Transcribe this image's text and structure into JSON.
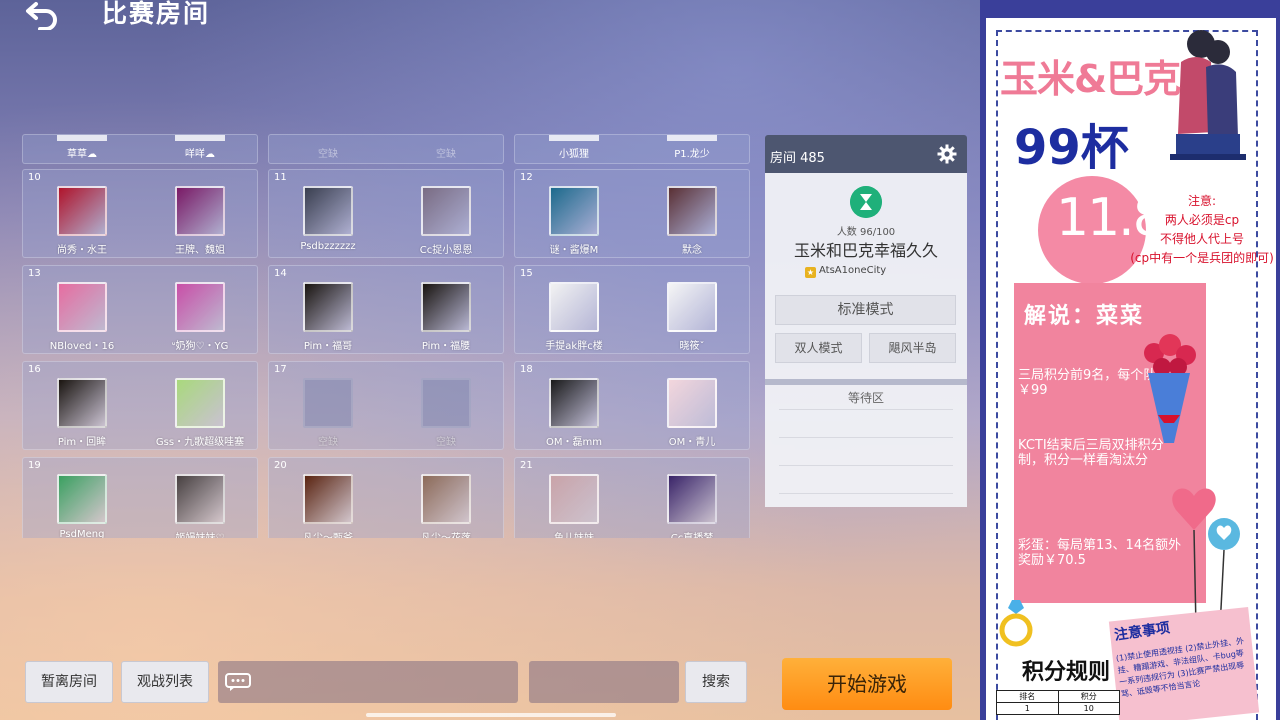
{
  "header": {
    "title": "比赛房间",
    "back_icon": "back-arrow-icon"
  },
  "top_row": [
    {
      "players": [
        {
          "name": "草草☁",
          "empty": false
        },
        {
          "name": "咩咩☁",
          "empty": false
        }
      ]
    },
    {
      "players": [
        {
          "name": "空缺",
          "empty": true
        },
        {
          "name": "空缺",
          "empty": true
        }
      ]
    },
    {
      "players": [
        {
          "name": "小狐狸",
          "empty": false
        },
        {
          "name": "P1.龙少",
          "empty": false
        }
      ]
    }
  ],
  "slots": [
    {
      "num": "10",
      "players": [
        {
          "name": "尚秀・水王",
          "empty": false,
          "color": "#b0142b"
        },
        {
          "name": "王牌、魏姐",
          "empty": false,
          "color": "#7a1a66"
        }
      ]
    },
    {
      "num": "11",
      "players": [
        {
          "name": "Psdbzzzzzz",
          "empty": false,
          "color": "#3a3f4f"
        },
        {
          "name": "Cc捉小恩恩",
          "empty": false,
          "color": "#7a6c83"
        }
      ]
    },
    {
      "num": "12",
      "players": [
        {
          "name": "谜・酱爆M",
          "empty": false,
          "color": "#1c6a8c"
        },
        {
          "name": "默念",
          "empty": false,
          "color": "#5a3034"
        }
      ]
    },
    {
      "num": "13",
      "players": [
        {
          "name": "NBloved・16",
          "empty": false,
          "color": "#e76da0"
        },
        {
          "name": "ᐡ奶狗♡・YG",
          "empty": false,
          "color": "#c94fa7"
        }
      ]
    },
    {
      "num": "14",
      "players": [
        {
          "name": "Pim・福哥",
          "empty": false,
          "color": "#1a1510"
        },
        {
          "name": "Pim・福腰",
          "empty": false,
          "color": "#1a1510"
        }
      ]
    },
    {
      "num": "15",
      "players": [
        {
          "name": "手提ak胖c楼",
          "empty": false,
          "color": "#f2f2f2"
        },
        {
          "name": "晓筱ˇ",
          "empty": false,
          "color": "#f5f5f5"
        }
      ]
    },
    {
      "num": "16",
      "players": [
        {
          "name": "Pim・回眸",
          "empty": false,
          "color": "#1a1510"
        },
        {
          "name": "Gss・九歌超级哇塞",
          "empty": false,
          "color": "#a9d97c"
        }
      ]
    },
    {
      "num": "17",
      "players": [
        {
          "name": "空缺",
          "empty": true
        },
        {
          "name": "空缺",
          "empty": true
        }
      ]
    },
    {
      "num": "18",
      "players": [
        {
          "name": "OM・磊mm",
          "empty": false,
          "color": "#1a1a1a"
        },
        {
          "name": "OM・青儿",
          "empty": false,
          "color": "#f3d6dc"
        }
      ]
    },
    {
      "num": "19",
      "players": [
        {
          "name": "PsdMeng",
          "empty": false,
          "color": "#3aa060"
        },
        {
          "name": "姬嫚妹妹♡",
          "empty": false,
          "color": "#474040"
        }
      ]
    },
    {
      "num": "20",
      "players": [
        {
          "name": "凡尘～甄爷",
          "empty": false,
          "color": "#5a2410"
        },
        {
          "name": "凡尘～花落",
          "empty": false,
          "color": "#8c6a58"
        }
      ]
    },
    {
      "num": "21",
      "players": [
        {
          "name": "鱼儿妹妹",
          "empty": false,
          "color": "#c9a3a8"
        },
        {
          "name": "Cc直播梦",
          "empty": false,
          "color": "#3a2468"
        }
      ]
    }
  ],
  "room": {
    "title": "房间 485",
    "count": "人数 96/100",
    "name": "玉米和巴克幸福久久",
    "owner": "AtsA1oneCity",
    "mode_standard": "标准模式",
    "mode_duo": "双人模式",
    "map": "飓风半岛",
    "waiting_area": "等待区"
  },
  "bottom": {
    "leave": "暂离房间",
    "spectate": "观战列表",
    "search": "搜索",
    "start": "开始游戏"
  },
  "poster": {
    "title": "玉米&巴克",
    "cup": "99杯",
    "date": "11.8",
    "note_lines": [
      "注意:",
      "两人必须是cp",
      "不得他人代上号",
      "(cp中有一个是兵团的即可)"
    ],
    "host": "解说：菜菜",
    "rule1": "三局积分前9名，每个队伍￥99",
    "rule2": "KCTI结束后三局双排积分制，积分一样看淘汰分",
    "rule3": "彩蛋：每局第13、14名额外奖励￥70.5",
    "notes_title": "注意事项",
    "notes_text": "(1)禁止使用透视挂 (2)禁止外挂、外挂、糟蹋游戏、非法组队、卡bug等一系列违规行为 (3)比赛严禁出现辱骂、诋毁等不恰当言论",
    "score_title": "积分规则",
    "table_header": [
      "排名",
      "积分"
    ],
    "table_row": [
      "1",
      "10"
    ]
  }
}
